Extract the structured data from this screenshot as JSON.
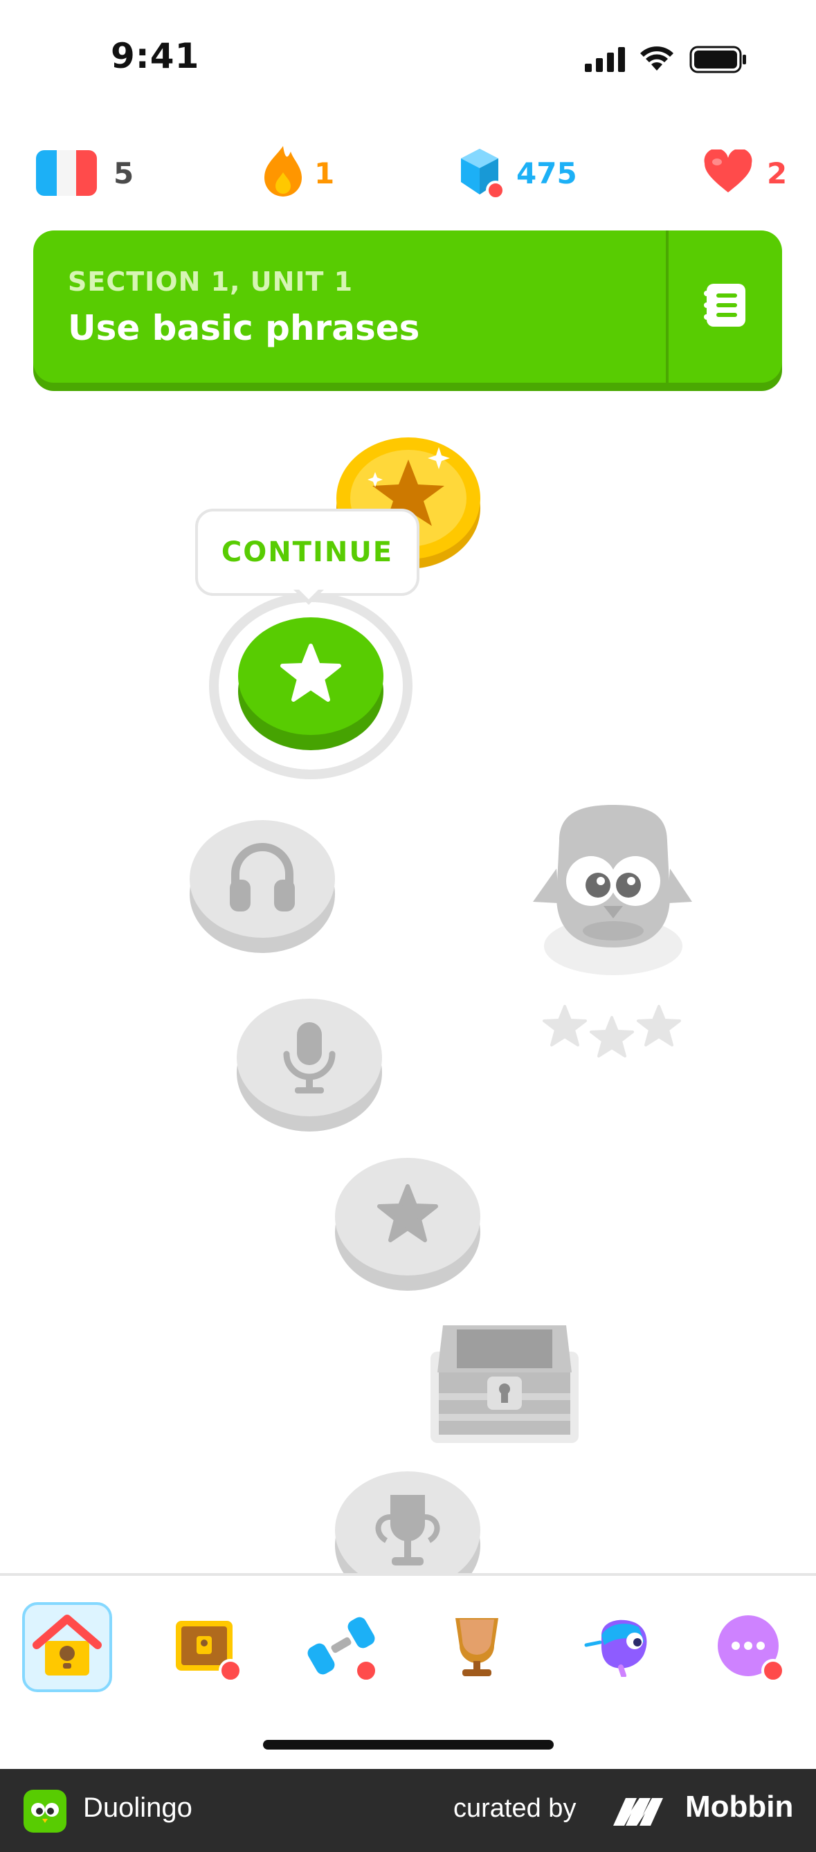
{
  "status_bar": {
    "time": "9:41"
  },
  "stats": {
    "course_days": "5",
    "streak": "1",
    "gems": "475",
    "hearts": "2"
  },
  "unit": {
    "section": "SECTION 1, UNIT 1",
    "title": "Use basic phrases"
  },
  "path": {
    "continue_label": "CONTINUE"
  },
  "nav": {
    "items": [
      "home",
      "treasure",
      "practice",
      "leaderboard",
      "super",
      "more"
    ]
  },
  "footer": {
    "app_name": "Duolingo",
    "curated_by": "curated by",
    "brand": "Mobbin"
  },
  "colors": {
    "green": "#58cc02",
    "gray": "#e5e5e5",
    "red": "#ff4b4b",
    "blue": "#1cb0f6",
    "orange": "#ff9600"
  }
}
